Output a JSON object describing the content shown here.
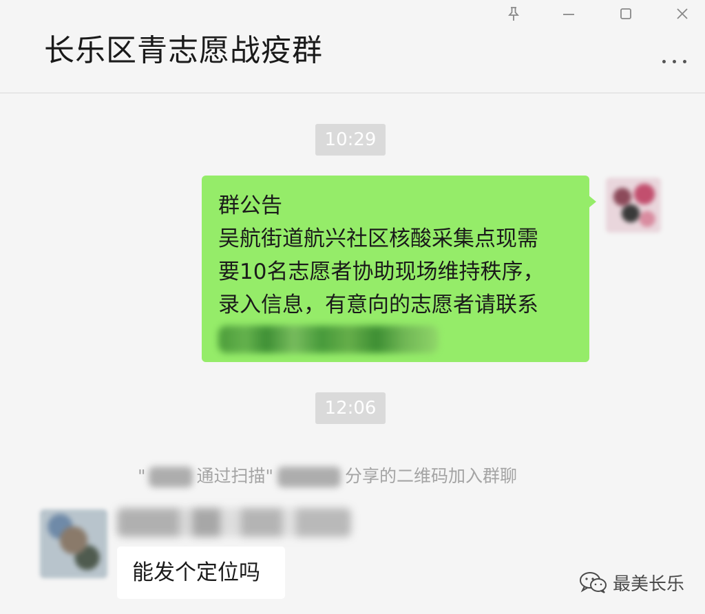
{
  "window": {
    "controls": [
      "pin-icon",
      "minimize-icon",
      "maximize-icon",
      "close-icon"
    ]
  },
  "header": {
    "title": "长乐区青志愿战疫群",
    "more_icon": "more-icon"
  },
  "messages": {
    "timestamp_1": "10:29",
    "announcement": {
      "heading": "群公告",
      "line1": "吴航街道航兴社区核酸采集点现需",
      "line2": "要10名志愿者协助现场维持秩序，",
      "line3": "录入信息，有意向的志愿者请联系"
    },
    "timestamp_2": "12:06",
    "system_notice": {
      "open_quote": "\"",
      "middle": "通过扫描\"",
      "tail": "分享的二维码加入群聊"
    },
    "received": {
      "text": "能发个定位吗"
    }
  },
  "watermark": {
    "text": "最美长乐",
    "icon": "wechat-icon"
  },
  "colors": {
    "sent_bubble": "#95ec69",
    "background": "#f5f5f5",
    "timestamp_bg": "#dadada"
  }
}
